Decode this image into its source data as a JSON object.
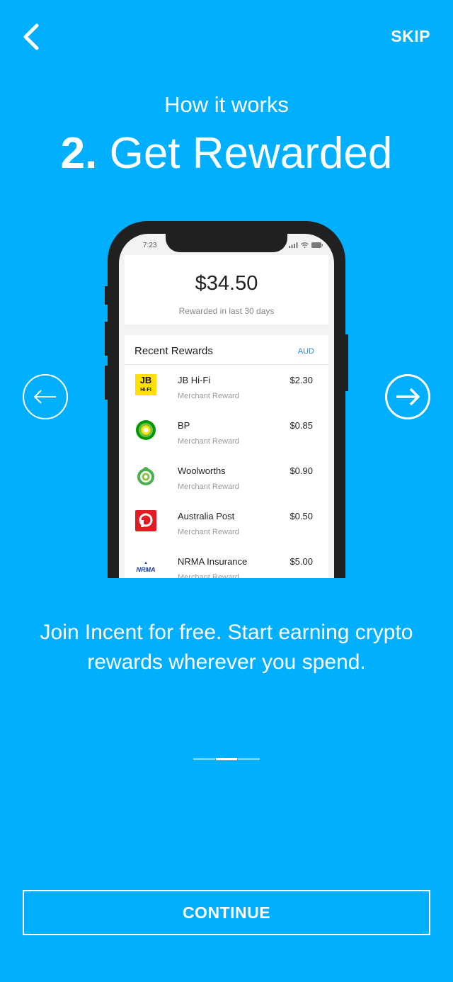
{
  "nav": {
    "skip_label": "SKIP",
    "back_icon": "chevron-left-icon"
  },
  "header": {
    "subtitle": "How it works",
    "step_number": "2.",
    "step_title": "Get Rewarded"
  },
  "phone": {
    "time": "7:23",
    "balance": "$34.50",
    "balance_caption": "Rewarded in last 30 days",
    "rewards_header": "Recent Rewards",
    "currency": "AUD",
    "rewards": [
      {
        "merchant": "JB Hi-Fi",
        "type": "Merchant Reward",
        "amount": "$2.30",
        "logo_text": "JB HI-FI",
        "logo_icon": "jb-hifi-logo"
      },
      {
        "merchant": "BP",
        "type": "Merchant Reward",
        "amount": "$0.85",
        "logo_icon": "bp-logo"
      },
      {
        "merchant": "Woolworths",
        "type": "Merchant Reward",
        "amount": "$0.90",
        "logo_icon": "woolworths-logo"
      },
      {
        "merchant": "Australia Post",
        "type": "Merchant Reward",
        "amount": "$0.50",
        "logo_icon": "australia-post-logo"
      },
      {
        "merchant": "NRMA Insurance",
        "type": "Merchant Reward",
        "amount": "$5.00",
        "logo_text": "NRMA",
        "logo_icon": "nrma-logo"
      }
    ]
  },
  "description": "Join Incent for free. Start earning crypto rewards wherever you spend.",
  "pager": {
    "count": 3,
    "active": 2
  },
  "continue_label": "CONTINUE",
  "colors": {
    "background": "#00b0ff",
    "accent": "#1e88e5",
    "phone_frame": "#202020"
  }
}
